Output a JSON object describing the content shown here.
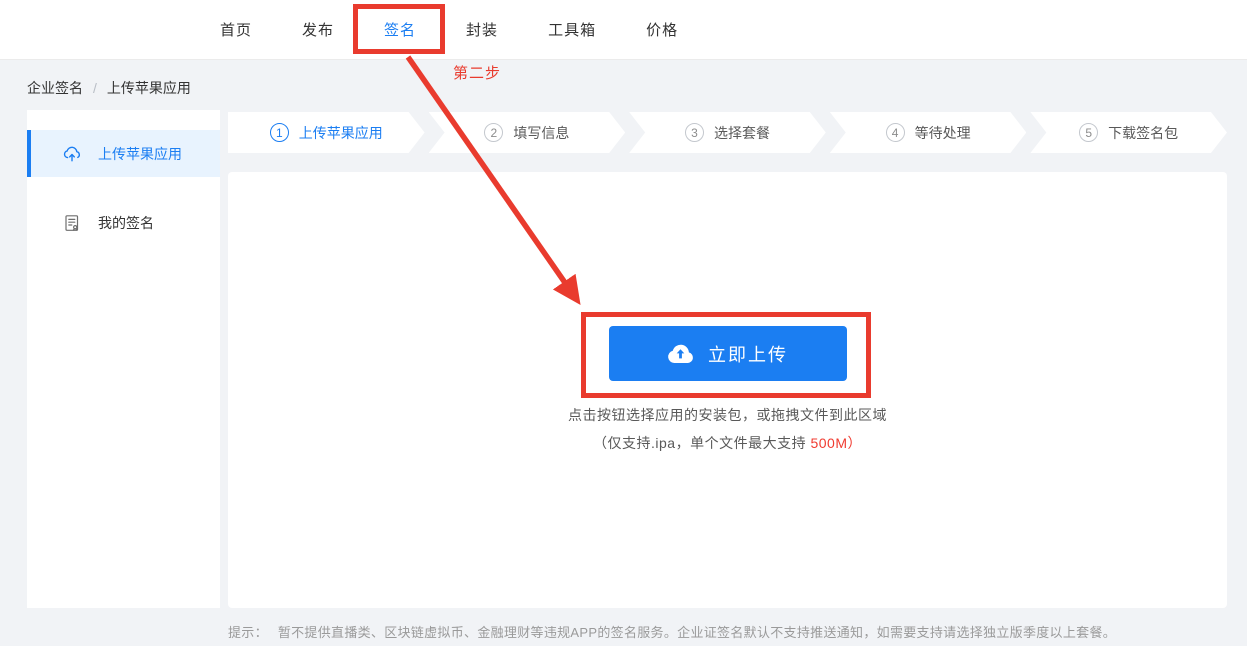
{
  "nav": {
    "items": [
      {
        "label": "首页",
        "active": false
      },
      {
        "label": "发布",
        "active": false
      },
      {
        "label": "签名",
        "active": true
      },
      {
        "label": "封装",
        "active": false
      },
      {
        "label": "工具箱",
        "active": false
      },
      {
        "label": "价格",
        "active": false
      }
    ]
  },
  "annotations": {
    "step_label": "第二步"
  },
  "breadcrumb": {
    "section": "企业签名",
    "separator": "/",
    "current": "上传苹果应用"
  },
  "sidebar": {
    "items": [
      {
        "label": "上传苹果应用",
        "icon": "cloud-upload-icon",
        "active": true
      },
      {
        "label": "我的签名",
        "icon": "signature-doc-icon",
        "active": false
      }
    ]
  },
  "steps": {
    "items": [
      {
        "number": "1",
        "label": "上传苹果应用",
        "active": true
      },
      {
        "number": "2",
        "label": "填写信息",
        "active": false
      },
      {
        "number": "3",
        "label": "选择套餐",
        "active": false
      },
      {
        "number": "4",
        "label": "等待处理",
        "active": false
      },
      {
        "number": "5",
        "label": "下载签名包",
        "active": false
      }
    ]
  },
  "upload": {
    "button_label": "立即上传",
    "hint_line1": "点击按钮选择应用的安装包，或拖拽文件到此区域",
    "hint_line2_prefix": "（仅支持.ipa，单个文件最大支持 ",
    "hint_line2_highlight": "500M",
    "hint_line2_suffix": "）"
  },
  "footer": {
    "tip_label": "提示：",
    "tip_text": "暂不提供直播类、区块链虚拟币、金融理财等违规APP的签名服务。企业证签名默认不支持推送通知，如需要支持请选择独立版季度以上套餐。"
  },
  "colors": {
    "accent_blue": "#1b7ef2",
    "annotation_red": "#e93b2e",
    "highlight_red": "#f03b30",
    "page_background": "#f1f3f6"
  }
}
